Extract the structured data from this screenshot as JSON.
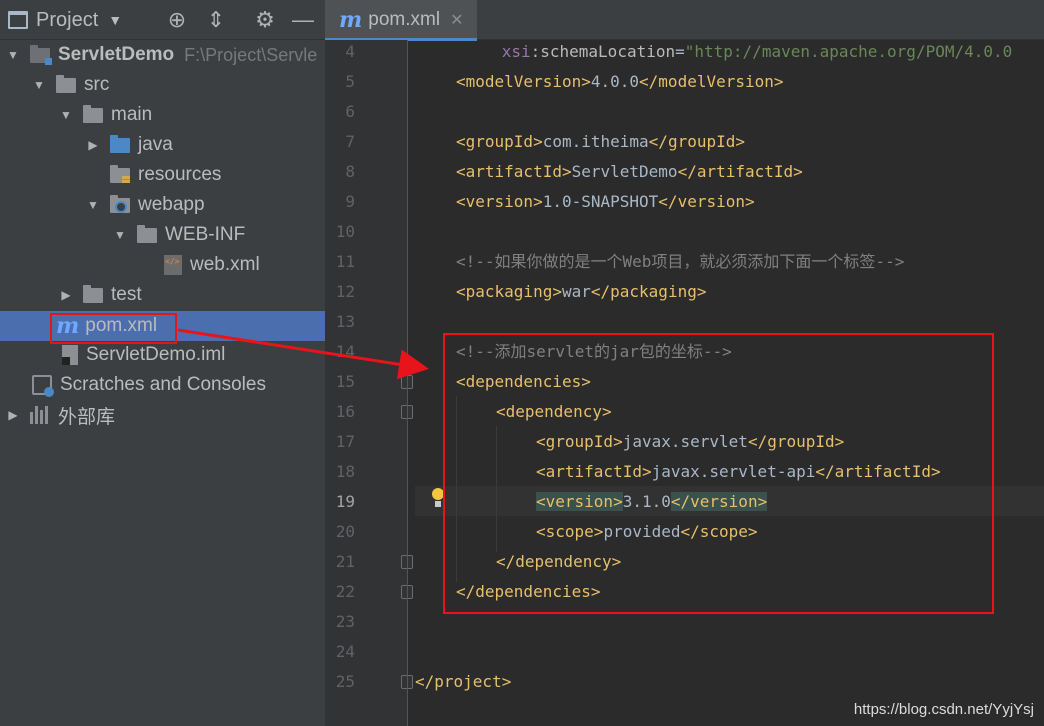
{
  "project_panel": {
    "title": "Project",
    "tree": [
      {
        "label": "ServletDemo",
        "path": "F:\\Project\\Servle"
      },
      {
        "label": "src"
      },
      {
        "label": "main"
      },
      {
        "label": "java"
      },
      {
        "label": "resources"
      },
      {
        "label": "webapp"
      },
      {
        "label": "WEB-INF"
      },
      {
        "label": "web.xml"
      },
      {
        "label": "test"
      },
      {
        "label": "pom.xml"
      },
      {
        "label": "ServletDemo.iml"
      },
      {
        "label": "Scratches and Consoles"
      },
      {
        "label": "外部库"
      }
    ]
  },
  "editor": {
    "tab": {
      "label": "pom.xml",
      "icon": "m"
    },
    "current_line": "19",
    "lines": [
      {
        "n": "4",
        "indent": "         ",
        "ns": "xsi",
        "colon": ":",
        "attr": "schemaLocation",
        "eq": "=",
        "val": "\"http://maven.apache.org/POM/4.0.0"
      },
      {
        "n": "5",
        "open": "<modelVersion>",
        "text": "4.0.0",
        "close": "</modelVersion>"
      },
      {
        "n": "6"
      },
      {
        "n": "7",
        "open": "<groupId>",
        "text": "com.itheima",
        "close": "</groupId>"
      },
      {
        "n": "8",
        "open": "<artifactId>",
        "text": "ServletDemo",
        "close": "</artifactId>"
      },
      {
        "n": "9",
        "open": "<version>",
        "text": "1.0-SNAPSHOT",
        "close": "</version>"
      },
      {
        "n": "10"
      },
      {
        "n": "11",
        "comment": "<!--如果你做的是一个Web项目，就必须添加下面一个标签-->"
      },
      {
        "n": "12",
        "open": "<packaging>",
        "text": "war",
        "close": "</packaging>"
      },
      {
        "n": "13"
      },
      {
        "n": "14",
        "comment": "<!--添加servlet的jar包的坐标-->"
      },
      {
        "n": "15",
        "open": "<dependencies>"
      },
      {
        "n": "16",
        "open": "<dependency>"
      },
      {
        "n": "17",
        "open": "<groupId>",
        "text": "javax.servlet",
        "close": "</groupId>"
      },
      {
        "n": "18",
        "open": "<artifactId>",
        "text": "javax.servlet-api",
        "close": "</artifactId>"
      },
      {
        "n": "19",
        "open": "<version>",
        "text": "3.1.0",
        "close": "</version>"
      },
      {
        "n": "20",
        "open": "<scope>",
        "text": "provided",
        "close": "</scope>"
      },
      {
        "n": "21",
        "open": "</dependency>"
      },
      {
        "n": "22",
        "open": "</dependencies>"
      },
      {
        "n": "23"
      },
      {
        "n": "24"
      },
      {
        "n": "25",
        "open": "</project>"
      }
    ]
  },
  "watermark": "https://blog.csdn.net/YyjYsj",
  "colors": {
    "annotation_red": "#e8141b",
    "selection_blue": "#4b6eaf",
    "tag_yellow": "#e8bf6a"
  }
}
